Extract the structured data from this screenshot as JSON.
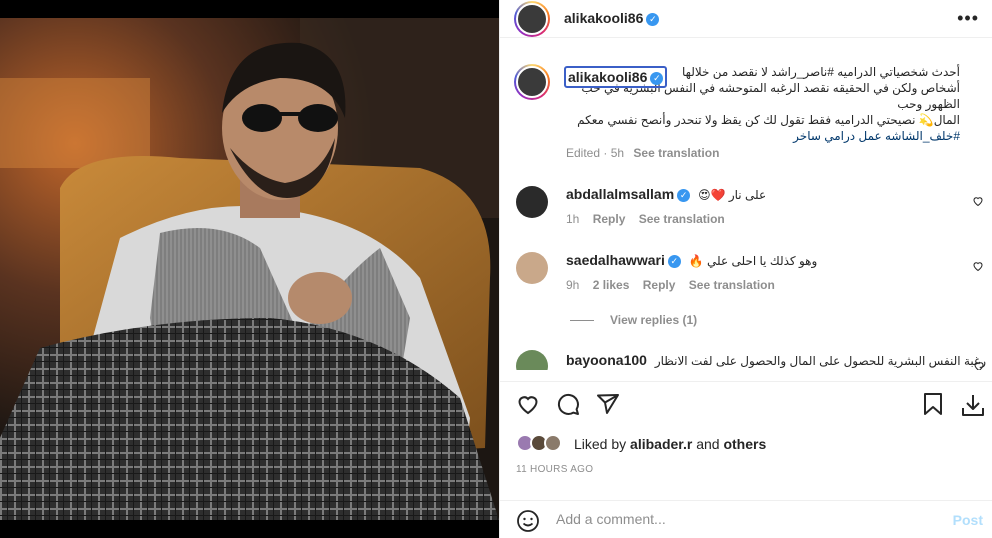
{
  "post": {
    "username": "alikakooli86",
    "more_icon": "more-horizontal-icon",
    "caption_lines": [
      "أحدث شخصياتي الدراميه #ناصر_راشد لا نقصد من خلالها",
      "أشخاص ولكن في الحقيقه نقصد الرغبه المتوحشه في النفس البشريه في حب الظهور وحب",
      "المال💫 نصيحتي الدراميه فقط تقول لك كن يقظ ولا تنحدر وأنصح نفسي معكم",
      "#خلف_الشاشه عمل درامي ساخر"
    ],
    "caption_meta": {
      "edited": "Edited · 5h",
      "see_translation": "See translation"
    }
  },
  "comments": [
    {
      "username": "abdallalmsallam",
      "verified": true,
      "text": "على نار ❤️😍",
      "time": "1h",
      "likes": "",
      "reply": "Reply",
      "see_translation": "See translation"
    },
    {
      "username": "saedalhawwari",
      "verified": true,
      "text": "وهو كذلك يا احلى علي 🔥",
      "time": "9h",
      "likes": "2 likes",
      "reply": "Reply",
      "see_translation": "See translation",
      "view_replies": "View replies (1)"
    },
    {
      "username": "bayoona100",
      "verified": false,
      "text": "رغبة النفس البشرية للحصول على المال والحصول على لفت الانظار"
    }
  ],
  "actions": {
    "like_icon": "heart-icon",
    "comment_icon": "comment-icon",
    "share_icon": "share-icon",
    "save_icon": "bookmark-icon",
    "download_icon": "download-icon"
  },
  "likes": {
    "prefix": "Liked by",
    "user": "alibader.r",
    "and": "and",
    "others": "others"
  },
  "timestamp": "11 HOURS AGO",
  "comment_box": {
    "emoji_icon": "emoji-icon",
    "placeholder": "Add a comment...",
    "post_label": "Post"
  },
  "colors": {
    "link": "#00376b",
    "verified": "#3897f0",
    "post_disabled": "#b2dffc",
    "meta": "#8e8e8e"
  }
}
